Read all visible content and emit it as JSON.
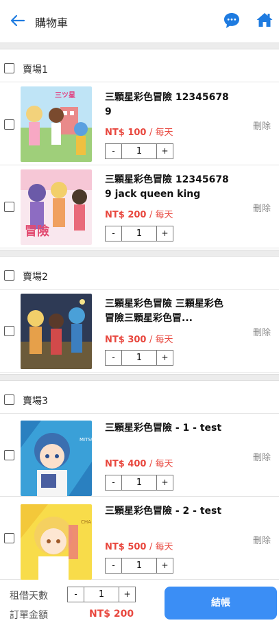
{
  "header": {
    "title": "購物車",
    "back_icon": "arrow-left-icon",
    "chat_icon": "chat-bubble-icon",
    "home_icon": "home-icon",
    "accent_color": "#1e7be0"
  },
  "sections": [
    {
      "label": "賣場1",
      "items": [
        {
          "name": "三顆星彩色冒險 123456789",
          "price": "NT$ 100",
          "per": "/ 每天",
          "quantity": "1",
          "delete_label": "刪除"
        },
        {
          "name": "三顆星彩色冒險 123456789 jack queen king",
          "price": "NT$ 200",
          "per": "/ 每天",
          "quantity": "1",
          "delete_label": "刪除"
        }
      ]
    },
    {
      "label": "賣場2",
      "items": [
        {
          "name": "三顆星彩色冒險 三顆星彩色冒險三顆星彩色冒...",
          "price": "NT$ 300",
          "per": "/ 每天",
          "quantity": "1",
          "delete_label": "刪除"
        }
      ]
    },
    {
      "label": "賣場3",
      "items": [
        {
          "name": "三顆星彩色冒險 - 1 - test",
          "price": "NT$ 400",
          "per": "/ 每天",
          "quantity": "1",
          "delete_label": "刪除"
        },
        {
          "name": "三顆星彩色冒險 - 2 - test",
          "price": "NT$ 500",
          "per": "/ 每天",
          "quantity": "1",
          "delete_label": "刪除"
        }
      ]
    }
  ],
  "stepper": {
    "minus": "-",
    "plus": "+"
  },
  "footer": {
    "days_label": "租借天數",
    "days_value": "1",
    "total_label": "訂單金額",
    "total_value": "NT$ 200",
    "checkout_label": "結帳",
    "checkout_color": "#3b8ef5"
  },
  "price_color": "#e8473e"
}
